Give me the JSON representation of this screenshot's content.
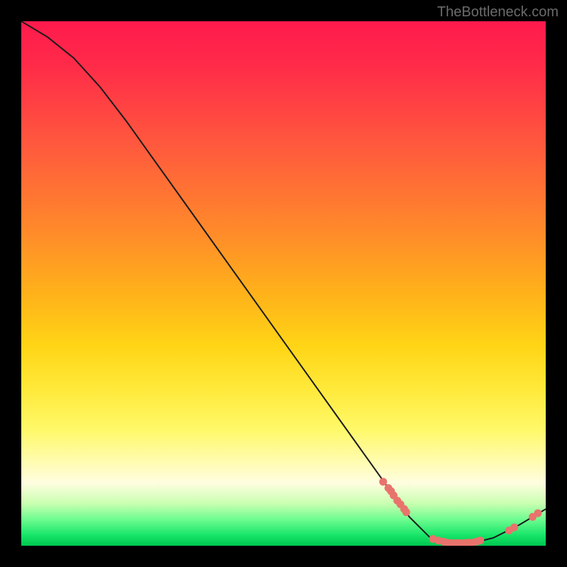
{
  "watermark": "TheBottleneck.com",
  "colors": {
    "plot_border": "#000000",
    "line": "#1a1a1a",
    "marker": "#e8736c"
  },
  "chart_data": {
    "type": "line",
    "title": "",
    "xlabel": "",
    "ylabel": "",
    "xlim": [
      0,
      100
    ],
    "ylim": [
      0,
      100
    ],
    "curve_points": [
      {
        "x": 0,
        "y": 100
      },
      {
        "x": 5,
        "y": 97
      },
      {
        "x": 10,
        "y": 93
      },
      {
        "x": 15,
        "y": 87.5
      },
      {
        "x": 20,
        "y": 81
      },
      {
        "x": 25,
        "y": 74
      },
      {
        "x": 30,
        "y": 67
      },
      {
        "x": 35,
        "y": 60
      },
      {
        "x": 40,
        "y": 53
      },
      {
        "x": 45,
        "y": 46
      },
      {
        "x": 50,
        "y": 39
      },
      {
        "x": 55,
        "y": 32
      },
      {
        "x": 60,
        "y": 25
      },
      {
        "x": 65,
        "y": 18
      },
      {
        "x": 70,
        "y": 11
      },
      {
        "x": 74,
        "y": 5.5
      },
      {
        "x": 78,
        "y": 1.5
      },
      {
        "x": 82,
        "y": 0.5
      },
      {
        "x": 86,
        "y": 0.5
      },
      {
        "x": 90,
        "y": 1.5
      },
      {
        "x": 95,
        "y": 4
      },
      {
        "x": 100,
        "y": 7
      }
    ],
    "marker_points": [
      {
        "x": 69,
        "y": 12.2
      },
      {
        "x": 70,
        "y": 11.0
      },
      {
        "x": 70.5,
        "y": 10.4
      },
      {
        "x": 71,
        "y": 9.6
      },
      {
        "x": 71.7,
        "y": 8.6
      },
      {
        "x": 72.3,
        "y": 7.9
      },
      {
        "x": 73,
        "y": 7.0
      },
      {
        "x": 73.4,
        "y": 6.4
      },
      {
        "x": 78.5,
        "y": 1.3
      },
      {
        "x": 79.5,
        "y": 1.0
      },
      {
        "x": 80.5,
        "y": 0.8
      },
      {
        "x": 81.2,
        "y": 0.6
      },
      {
        "x": 82.0,
        "y": 0.5
      },
      {
        "x": 82.8,
        "y": 0.5
      },
      {
        "x": 83.6,
        "y": 0.5
      },
      {
        "x": 84.4,
        "y": 0.5
      },
      {
        "x": 85.2,
        "y": 0.6
      },
      {
        "x": 86.0,
        "y": 0.6
      },
      {
        "x": 86.8,
        "y": 0.8
      },
      {
        "x": 87.5,
        "y": 1.0
      },
      {
        "x": 93.0,
        "y": 2.9
      },
      {
        "x": 94.0,
        "y": 3.5
      },
      {
        "x": 97.5,
        "y": 5.5
      },
      {
        "x": 98.5,
        "y": 6.2
      }
    ]
  }
}
